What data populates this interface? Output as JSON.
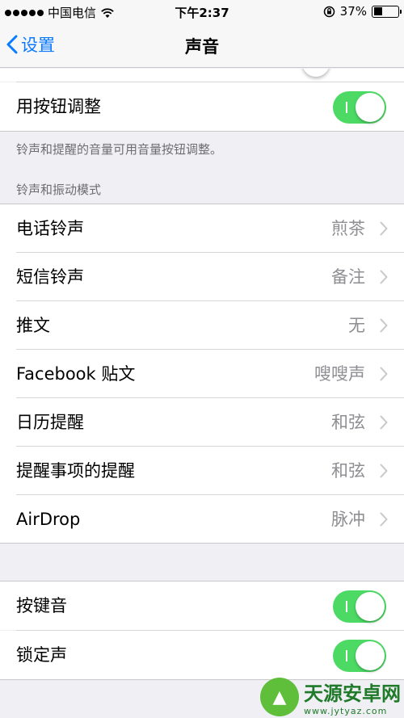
{
  "status_bar": {
    "carrier": "中国电信",
    "time": "下午2:37",
    "battery_percent": "37%",
    "battery_level": 0.37
  },
  "nav": {
    "back_label": "设置",
    "title": "声音"
  },
  "adjust_row": {
    "label": "用按钮调整",
    "on": true
  },
  "adjust_footer": "铃声和提醒的音量可用音量按钮调整。",
  "section_header": "铃声和振动模式",
  "sound_rows": [
    {
      "label": "电话铃声",
      "value": "煎茶"
    },
    {
      "label": "短信铃声",
      "value": "备注"
    },
    {
      "label": "推文",
      "value": "无"
    },
    {
      "label": "Facebook 贴文",
      "value": "嗖嗖声"
    },
    {
      "label": "日历提醒",
      "value": "和弦"
    },
    {
      "label": "提醒事项的提醒",
      "value": "和弦"
    },
    {
      "label": "AirDrop",
      "value": "脉冲"
    }
  ],
  "toggle_rows": [
    {
      "label": "按键音",
      "on": true
    },
    {
      "label": "锁定声",
      "on": true
    }
  ],
  "watermark": {
    "name": "天源安卓网",
    "url": "www.jytyaz.com"
  },
  "colors": {
    "accent": "#0a7aff",
    "toggle_on": "#4cd964",
    "background": "#efeff4"
  }
}
